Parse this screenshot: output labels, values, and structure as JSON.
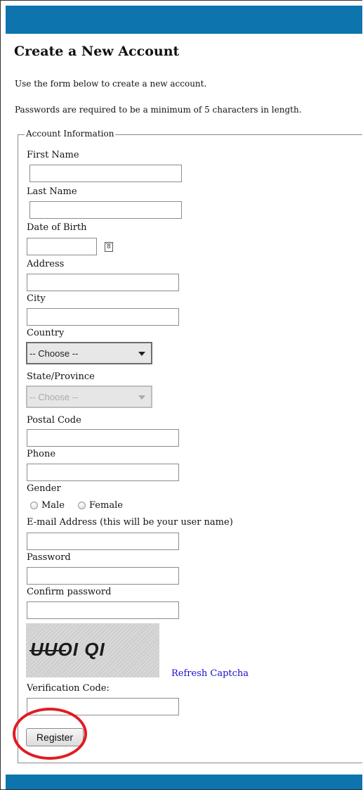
{
  "page": {
    "title": "Create a New Account",
    "intro": "Use the form below to create a new account.",
    "password_note": "Passwords are required to be a minimum of 5 characters in length."
  },
  "form": {
    "legend": "Account Information",
    "first_name": {
      "label": "First Name",
      "value": ""
    },
    "last_name": {
      "label": "Last Name",
      "value": ""
    },
    "dob": {
      "label": "Date of Birth",
      "value": "",
      "calendar_icon_text": "8"
    },
    "address": {
      "label": "Address",
      "value": ""
    },
    "city": {
      "label": "City",
      "value": ""
    },
    "country": {
      "label": "Country",
      "selected": "-- Choose --"
    },
    "state": {
      "label": "State/Province",
      "selected": "-- Choose --",
      "disabled": true
    },
    "postal_code": {
      "label": "Postal Code",
      "value": ""
    },
    "phone": {
      "label": "Phone",
      "value": ""
    },
    "gender": {
      "label": "Gender",
      "options": [
        "Male",
        "Female"
      ]
    },
    "email": {
      "label": "E-mail Address (this will be your user name)",
      "value": ""
    },
    "password": {
      "label": "Password",
      "value": ""
    },
    "confirm_password": {
      "label": "Confirm password",
      "value": ""
    },
    "captcha": {
      "text": "UUOI QI",
      "refresh_label": "Refresh Captcha"
    },
    "verification": {
      "label": "Verification Code:",
      "value": ""
    },
    "register_label": "Register"
  },
  "colors": {
    "header_bar": "#0d74ad",
    "link": "#1a0dcc",
    "highlight_circle": "#e21b23"
  }
}
